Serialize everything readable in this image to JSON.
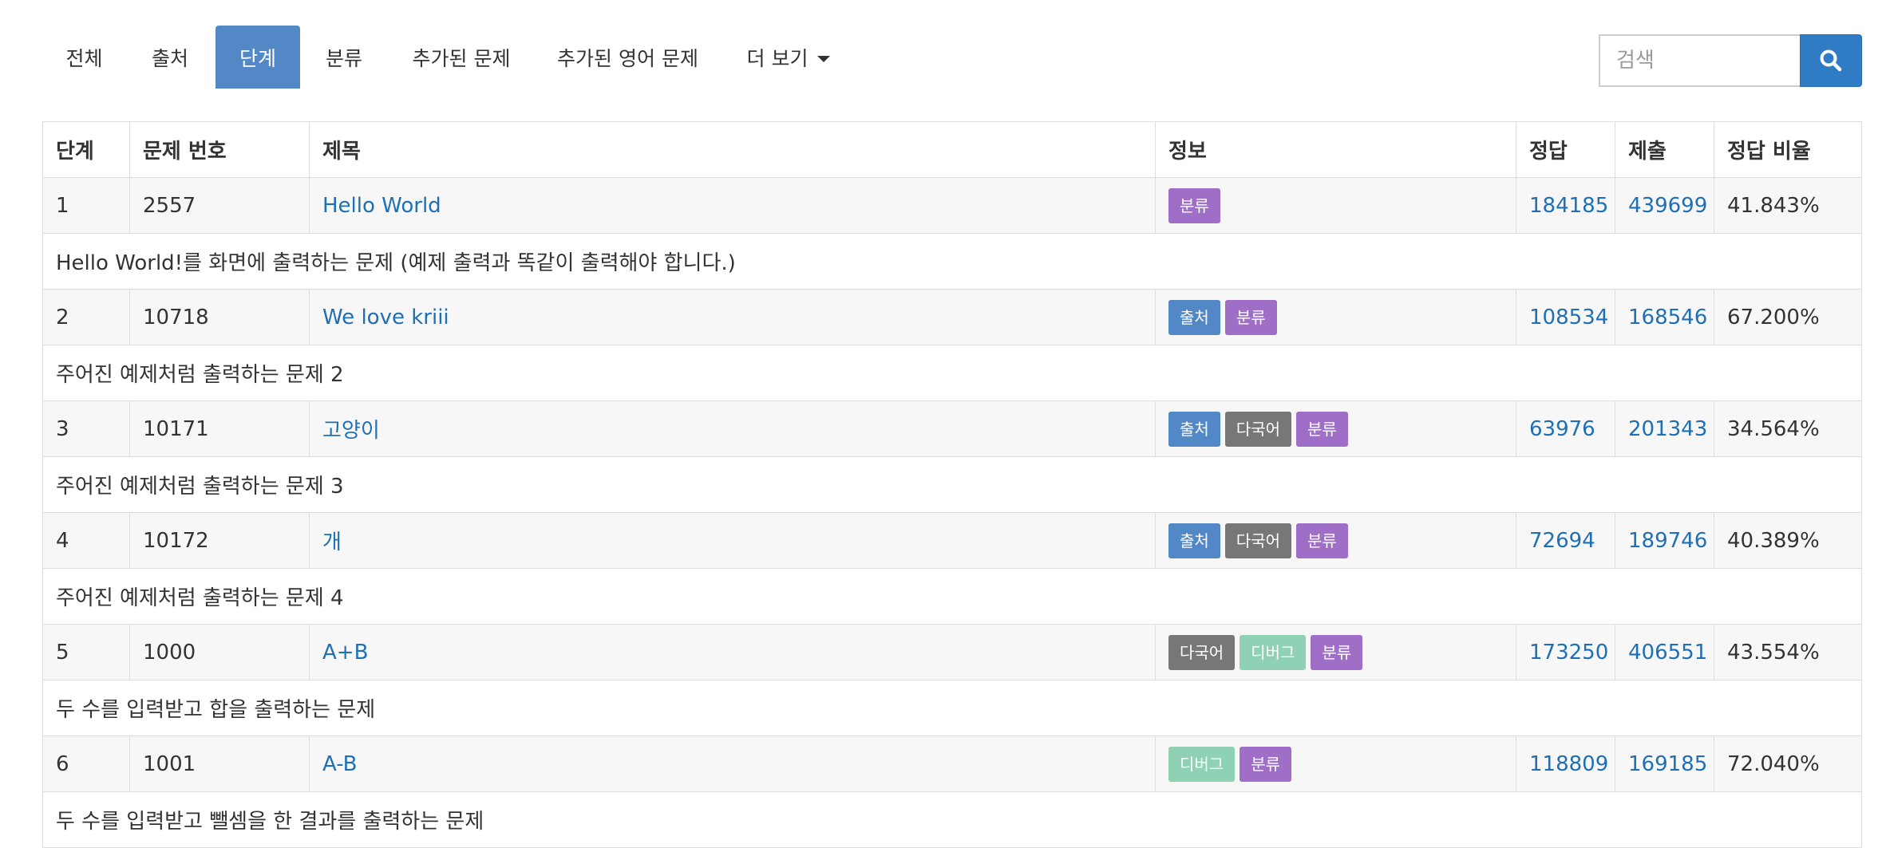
{
  "nav": {
    "tabs": [
      {
        "label": "전체",
        "active": false
      },
      {
        "label": "출처",
        "active": false
      },
      {
        "label": "단계",
        "active": true
      },
      {
        "label": "분류",
        "active": false
      },
      {
        "label": "추가된 문제",
        "active": false
      },
      {
        "label": "추가된 영어 문제",
        "active": false
      },
      {
        "label": "더 보기",
        "active": false,
        "dropdown": true
      }
    ]
  },
  "search": {
    "placeholder": "검색",
    "icon": "search-icon"
  },
  "table": {
    "headers": [
      "단계",
      "문제 번호",
      "제목",
      "정보",
      "정답",
      "제출",
      "정답 비율"
    ],
    "rows": [
      {
        "level": "1",
        "id": "2557",
        "title": "Hello World",
        "tags": [
          "분류"
        ],
        "correct": "184185",
        "submit": "439699",
        "ratio": "41.843%",
        "desc": "Hello World!를 화면에 출력하는 문제 (예제 출력과 똑같이 출력해야 합니다.)"
      },
      {
        "level": "2",
        "id": "10718",
        "title": "We love kriii",
        "tags": [
          "출처",
          "분류"
        ],
        "correct": "108534",
        "submit": "168546",
        "ratio": "67.200%",
        "desc": "주어진 예제처럼 출력하는 문제 2"
      },
      {
        "level": "3",
        "id": "10171",
        "title": "고양이",
        "tags": [
          "출처",
          "다국어",
          "분류"
        ],
        "correct": "63976",
        "submit": "201343",
        "ratio": "34.564%",
        "desc": "주어진 예제처럼 출력하는 문제 3"
      },
      {
        "level": "4",
        "id": "10172",
        "title": "개",
        "tags": [
          "출처",
          "다국어",
          "분류"
        ],
        "correct": "72694",
        "submit": "189746",
        "ratio": "40.389%",
        "desc": "주어진 예제처럼 출력하는 문제 4"
      },
      {
        "level": "5",
        "id": "1000",
        "title": "A+B",
        "tags": [
          "다국어",
          "디버그",
          "분류"
        ],
        "correct": "173250",
        "submit": "406551",
        "ratio": "43.554%",
        "desc": "두 수를 입력받고 합을 출력하는 문제"
      },
      {
        "level": "6",
        "id": "1001",
        "title": "A-B",
        "tags": [
          "디버그",
          "분류"
        ],
        "correct": "118809",
        "submit": "169185",
        "ratio": "72.040%",
        "desc": "두 수를 입력받고 뺄셈을 한 결과를 출력하는 문제"
      }
    ]
  },
  "colors": {
    "accent": "#5288c6",
    "search_button": "#2f7bc4",
    "link": "#1f6fb4",
    "tag_분류": "#9f6fc7",
    "tag_출처": "#5288c6",
    "tag_다국어": "#777777",
    "tag_디버그": "#8fd1b5"
  }
}
